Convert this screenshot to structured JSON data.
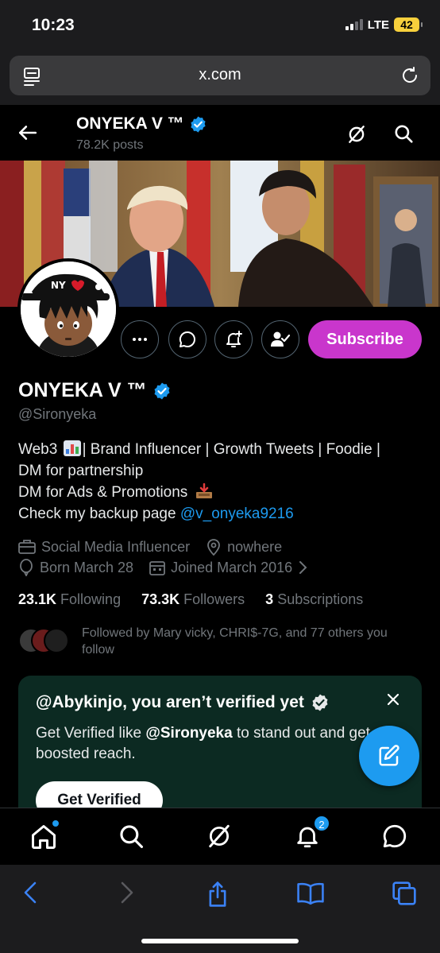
{
  "status": {
    "time": "10:23",
    "network": "LTE",
    "battery": "42"
  },
  "browser": {
    "url": "x.com"
  },
  "header": {
    "name": "ONYEKA V ™",
    "posts": "78.2K posts"
  },
  "profile": {
    "name": "ONYEKA V ™",
    "handle": "@Sironyeka",
    "bio_line1": "Web3",
    "bio_line1_rest": "| Brand Influencer | Growth Tweets | Foodie |",
    "bio_line2": "DM for partnership",
    "bio_line3": "DM for Ads & Promotions",
    "bio_line4_prefix": "Check my backup page ",
    "bio_link": "@v_onyeka9216",
    "category": "Social Media Influencer",
    "location": "nowhere",
    "born": "Born March 28",
    "joined": "Joined March 2016",
    "following_count": "23.1K",
    "following_label": "Following",
    "followers_count": "73.3K",
    "followers_label": "Followers",
    "subscriptions_count": "3",
    "subscriptions_label": "Subscriptions",
    "followed_by": "Followed by Mary vicky, CHRI$-7G, and 77 others you follow"
  },
  "actions": {
    "subscribe": "Subscribe"
  },
  "promo": {
    "title": "@Abykinjo, you aren’t verified yet",
    "text_prefix": "Get Verified like ",
    "text_handle": "@Sironyeka",
    "text_suffix": " to stand out and get boosted reach.",
    "button": "Get Verified"
  },
  "tabbar": {
    "notifications_badge": "2"
  },
  "colors": {
    "accent": "#1d9bf0",
    "subscribe": "#c936cc",
    "promo_bg": "#0c2a22",
    "muted": "#71767b"
  },
  "icons": [
    "back-arrow-icon",
    "grok-icon",
    "search-icon",
    "more-icon",
    "message-icon",
    "notify-icon",
    "follow-check-icon",
    "verified-icon",
    "briefcase-icon",
    "location-icon",
    "balloon-icon",
    "calendar-icon",
    "chevron-right-icon",
    "close-icon",
    "compose-icon",
    "home-icon",
    "bell-icon",
    "chat-icon",
    "share-icon",
    "bookmarks-icon",
    "tabs-icon"
  ]
}
